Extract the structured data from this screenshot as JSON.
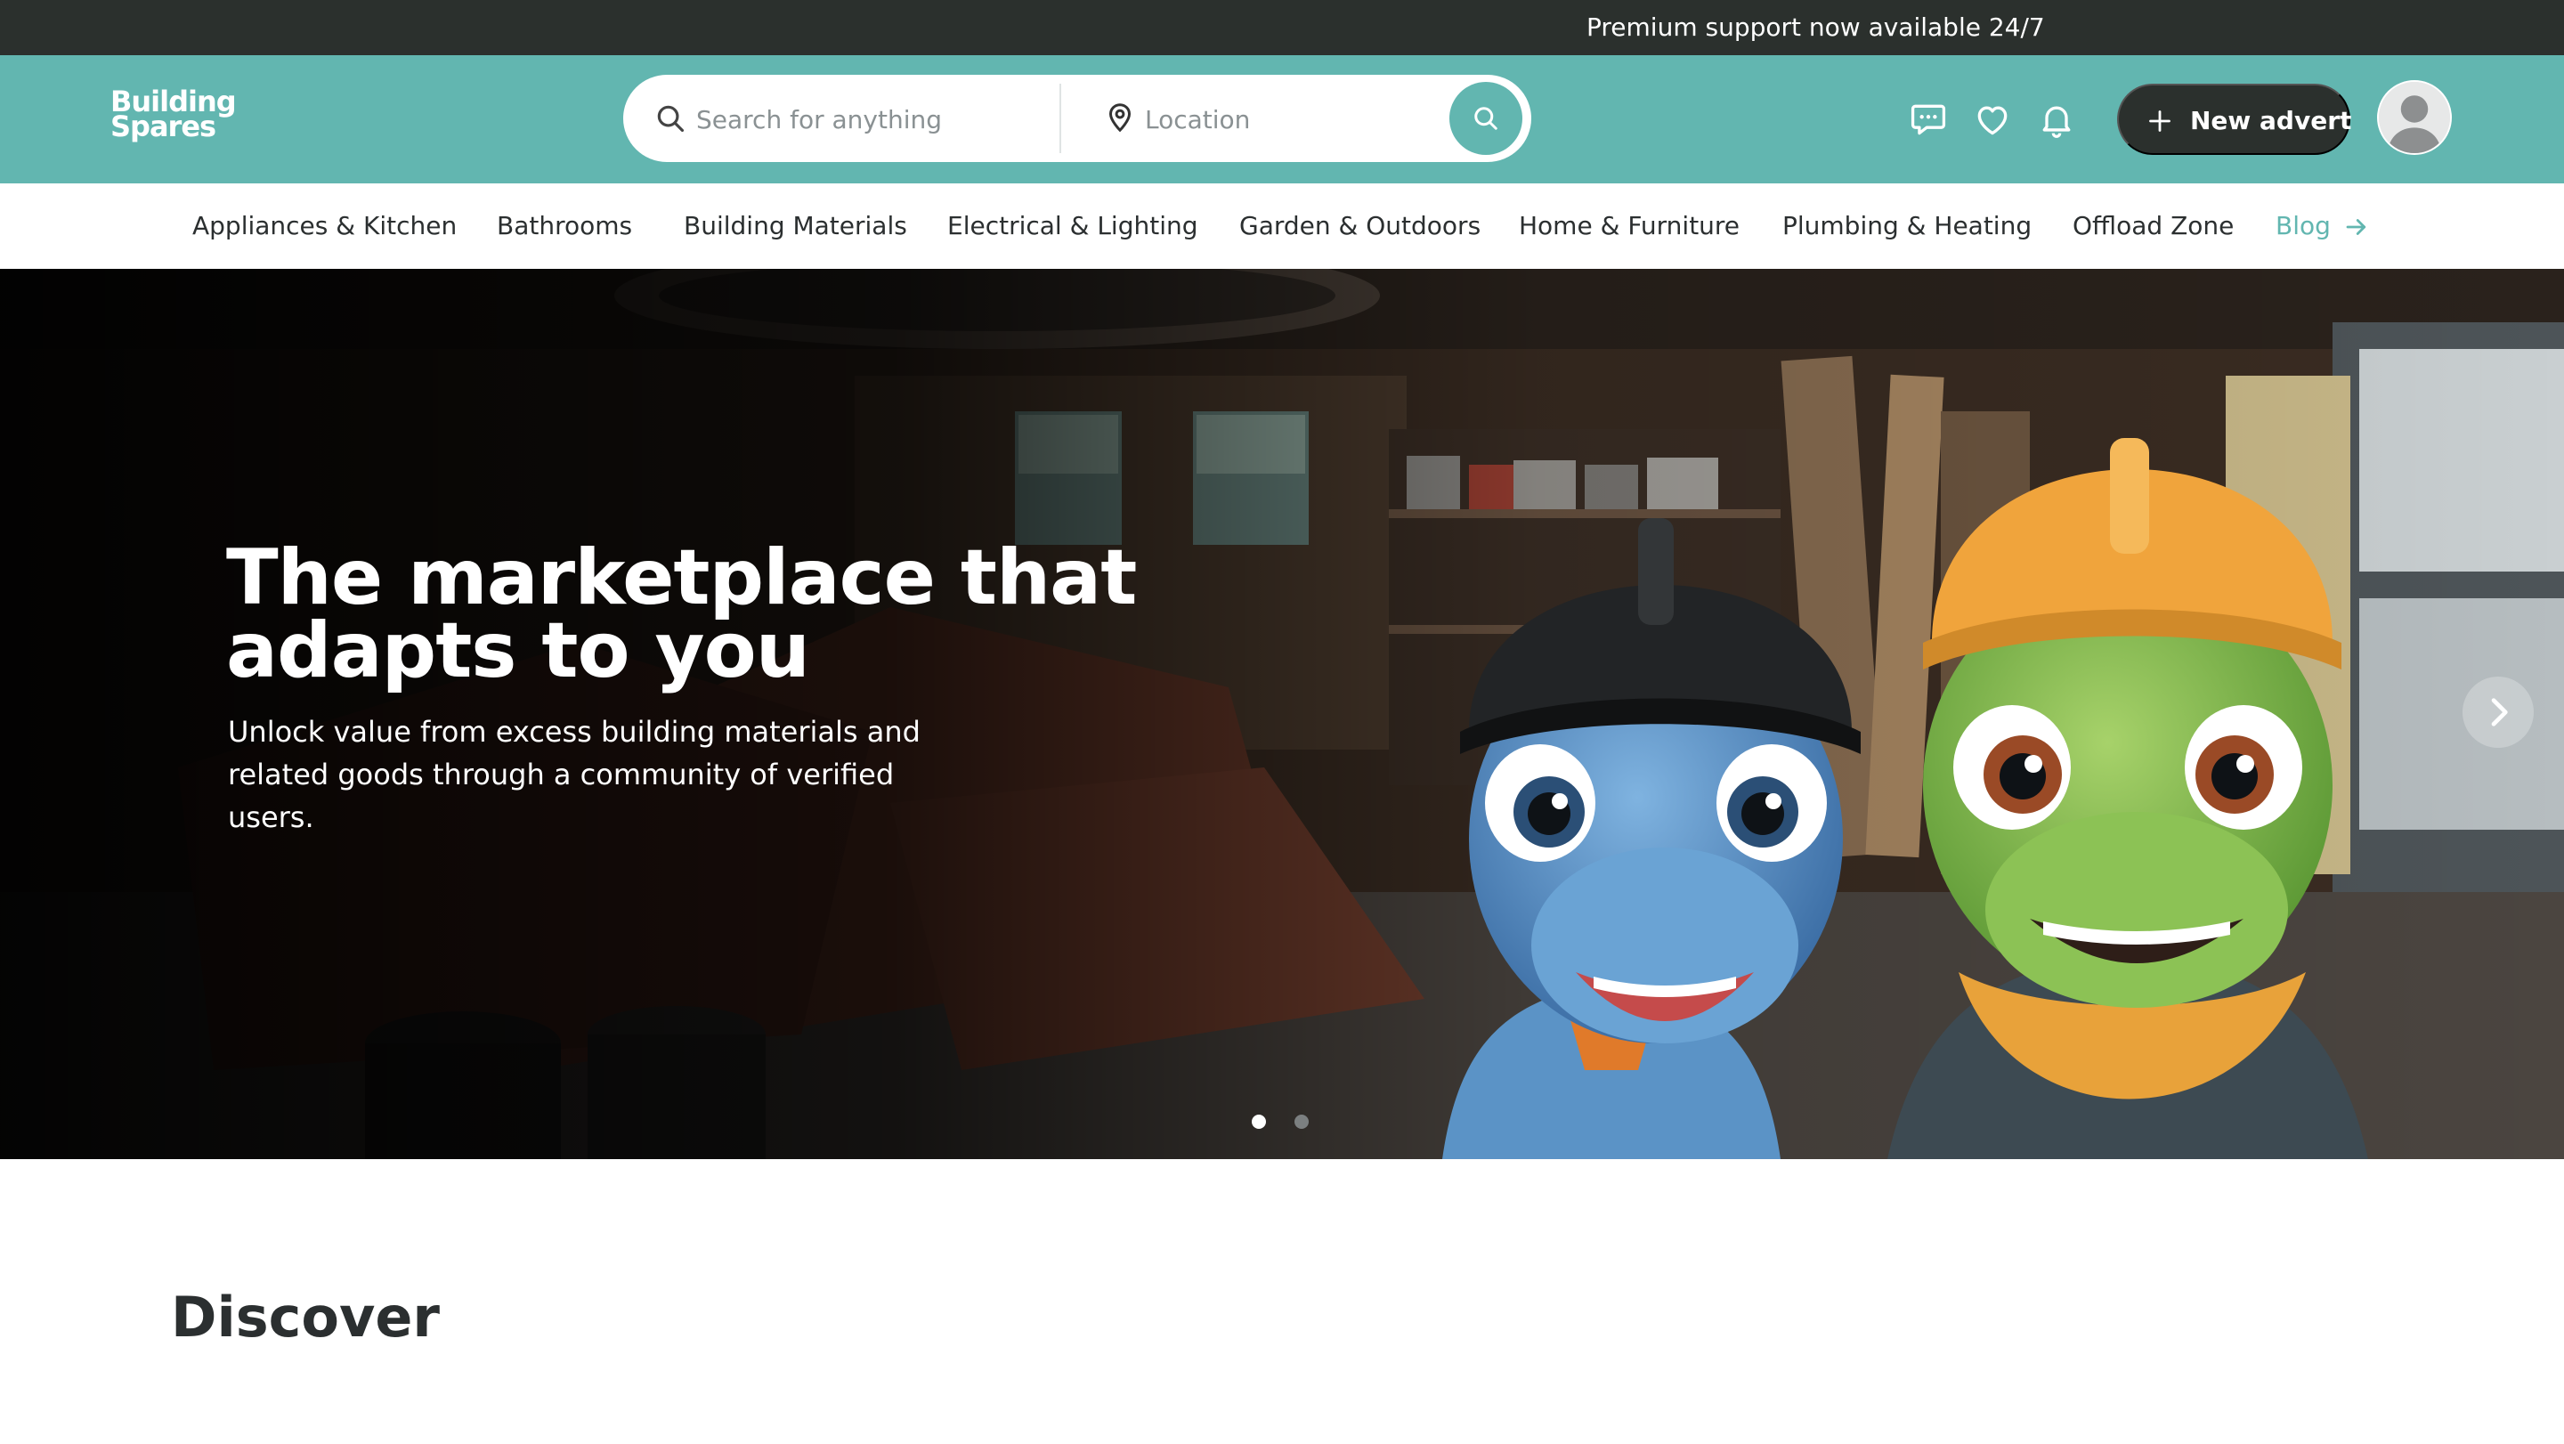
{
  "topbar": {
    "announcement": "Premium support now available 24/7"
  },
  "header": {
    "logo_line1": "Building",
    "logo_line2": "Spares",
    "search_placeholder": "Search for anything",
    "location_placeholder": "Location",
    "new_advert_label": "New advert",
    "icons": [
      "messages-icon",
      "heart-icon",
      "bell-icon",
      "search-icon",
      "location-pin-icon",
      "plus-icon"
    ]
  },
  "categories": [
    "Appliances & Kitchen",
    "Bathrooms",
    "Building Materials",
    "Electrical & Lighting",
    "Garden & Outdoors",
    "Home & Furniture",
    "Plumbing & Heating",
    "Offload Zone",
    "Blog"
  ],
  "hero": {
    "title": "The marketplace that adapts to you",
    "subtitle": "Unlock value from excess building materials and related goods through a community of verified users.",
    "slides_total": 2,
    "active_slide": 1
  },
  "discover": {
    "heading": "Discover"
  },
  "colors": {
    "topbar": "#2b302d",
    "header": "#62b6b0",
    "accent": "#62b6b0",
    "button_dark": "#2b302d",
    "text": "#2b2f30"
  }
}
